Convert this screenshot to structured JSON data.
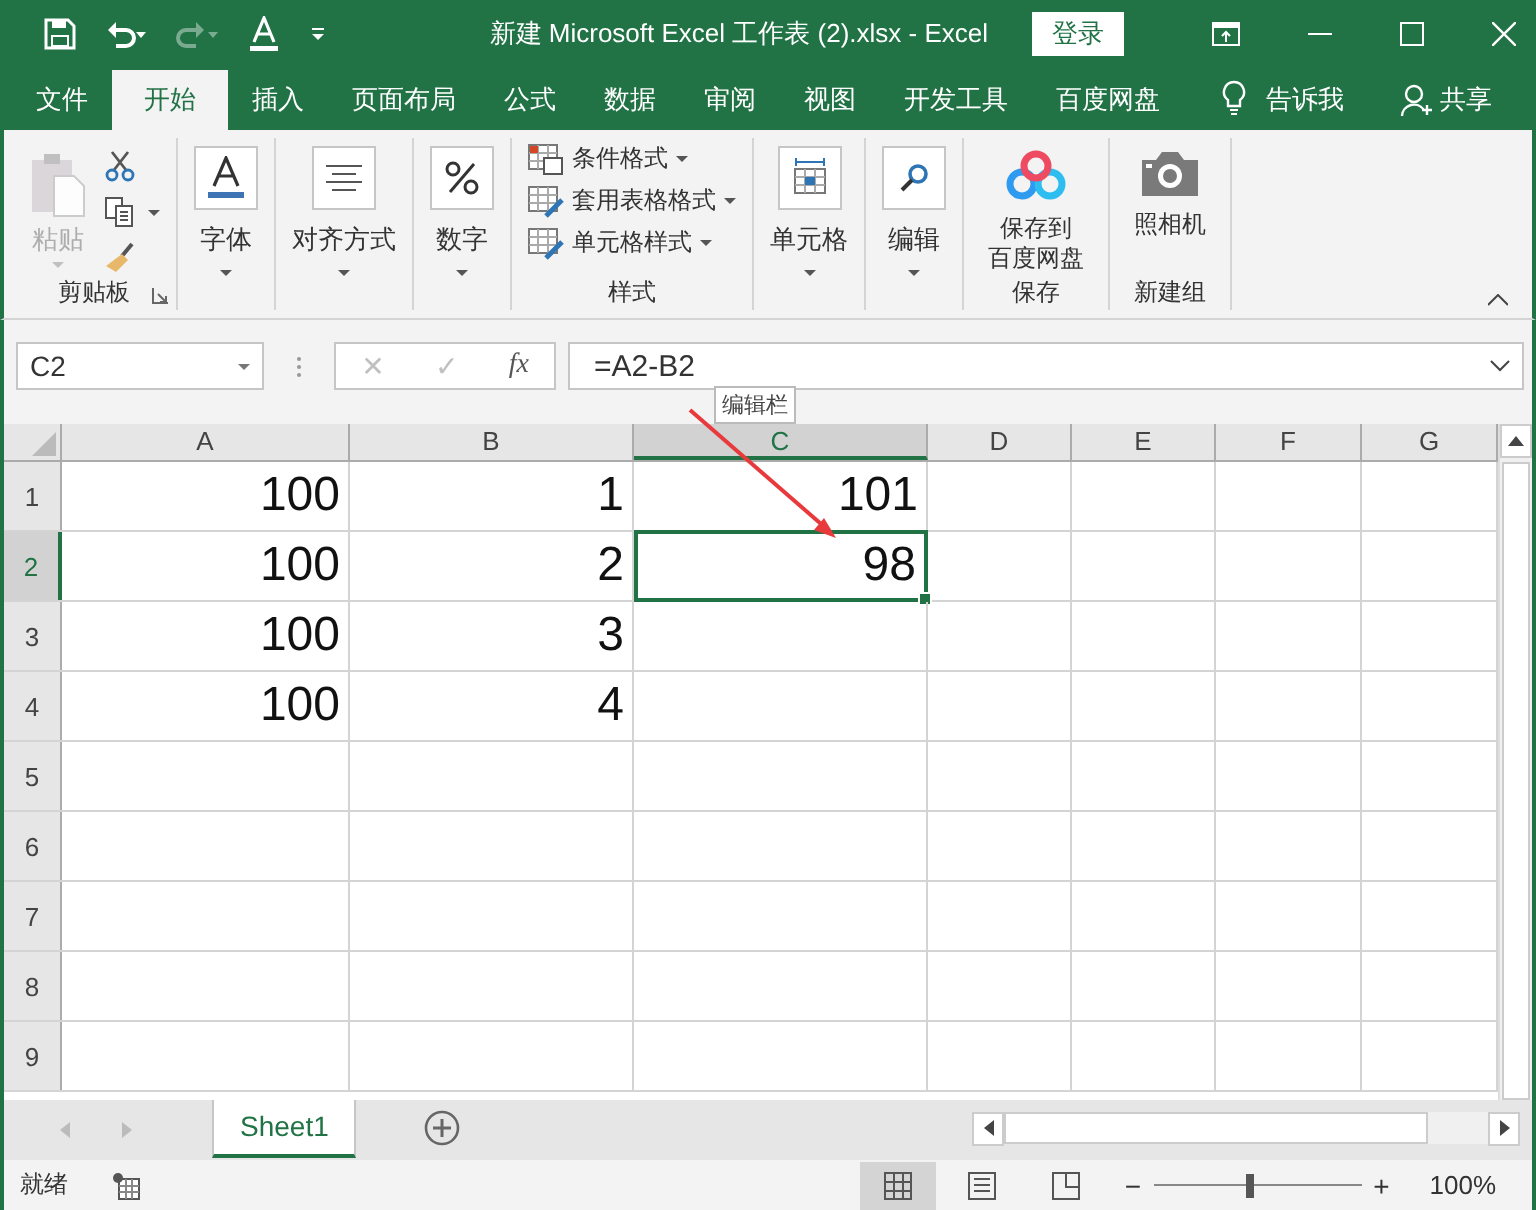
{
  "title_bar": {
    "title": "新建 Microsoft Excel 工作表 (2).xlsx - Excel",
    "sign_in": "登录",
    "redo_disabled": true
  },
  "tabs": [
    {
      "label": "文件",
      "selected": false
    },
    {
      "label": "开始",
      "selected": true
    },
    {
      "label": "插入",
      "selected": false
    },
    {
      "label": "页面布局",
      "selected": false
    },
    {
      "label": "公式",
      "selected": false
    },
    {
      "label": "数据",
      "selected": false
    },
    {
      "label": "审阅",
      "selected": false
    },
    {
      "label": "视图",
      "selected": false
    },
    {
      "label": "开发工具",
      "selected": false
    },
    {
      "label": "百度网盘",
      "selected": false
    }
  ],
  "tell_me": "告诉我",
  "share": "共享",
  "ribbon": [
    {
      "kind": "clipboard",
      "label": "剪贴板",
      "buttons": [
        {
          "label": "粘贴",
          "disabled": true,
          "dropdown": true
        },
        {
          "dropdown": true
        }
      ]
    },
    {
      "kind": "boxed",
      "buttons": [
        {
          "label": "字体",
          "dropdown": true
        }
      ]
    },
    {
      "kind": "boxed",
      "buttons": [
        {
          "label": "对齐方式",
          "dropdown": true
        }
      ]
    },
    {
      "kind": "boxed",
      "buttons": [
        {
          "label": "数字",
          "dropdown": true
        }
      ]
    },
    {
      "kind": "list",
      "label": "样式",
      "buttons": [
        {
          "label": "条件格式",
          "dropdown": true
        },
        {
          "label": "套用表格格式",
          "dropdown": true
        },
        {
          "label": "单元格样式",
          "dropdown": true
        }
      ]
    },
    {
      "kind": "boxed",
      "buttons": [
        {
          "label": "单元格",
          "dropdown": true
        }
      ]
    },
    {
      "kind": "boxed",
      "buttons": [
        {
          "label": "编辑",
          "dropdown": true
        }
      ]
    },
    {
      "kind": "large",
      "label": "保存",
      "buttons": [
        {
          "lines": [
            "保存到",
            "百度网盘"
          ]
        }
      ]
    },
    {
      "kind": "large",
      "label": "新建组",
      "buttons": [
        {
          "lines": [
            "照相机"
          ]
        }
      ]
    }
  ],
  "formula_bar": {
    "name_box": "C2",
    "cancel": "✕",
    "enter": "✓",
    "function": "fx",
    "formula": "=A2-B2",
    "tooltip": "编辑栏"
  },
  "columns": [
    {
      "label": "A",
      "selected": false
    },
    {
      "label": "B",
      "selected": false
    },
    {
      "label": "C",
      "selected": true
    },
    {
      "label": "D",
      "selected": false
    },
    {
      "label": "E",
      "selected": false
    },
    {
      "label": "F",
      "selected": false
    },
    {
      "label": "G",
      "selected": false
    }
  ],
  "rows": [
    {
      "label": "1",
      "selected": false,
      "cells": [
        "100",
        "1",
        "101"
      ]
    },
    {
      "label": "2",
      "selected": true,
      "cells": [
        "100",
        "2",
        "98"
      ]
    },
    {
      "label": "3",
      "selected": false,
      "cells": [
        "100",
        "3"
      ]
    },
    {
      "label": "4",
      "selected": false,
      "cells": [
        "100",
        "4"
      ]
    },
    {
      "label": "5",
      "selected": false
    },
    {
      "label": "6",
      "selected": false
    },
    {
      "label": "7",
      "selected": false
    },
    {
      "label": "8",
      "selected": false
    },
    {
      "label": "9",
      "selected": false
    }
  ],
  "sheets": [
    {
      "label": "Sheet1",
      "selected": true
    }
  ],
  "status_bar": {
    "status": "就绪",
    "views": [
      {
        "selected": true
      },
      {
        "selected": false
      },
      {
        "selected": false
      }
    ],
    "zoom": {
      "zoom_out": "−",
      "level": 0.47,
      "zoom_in": "+",
      "reading": "100%"
    }
  }
}
